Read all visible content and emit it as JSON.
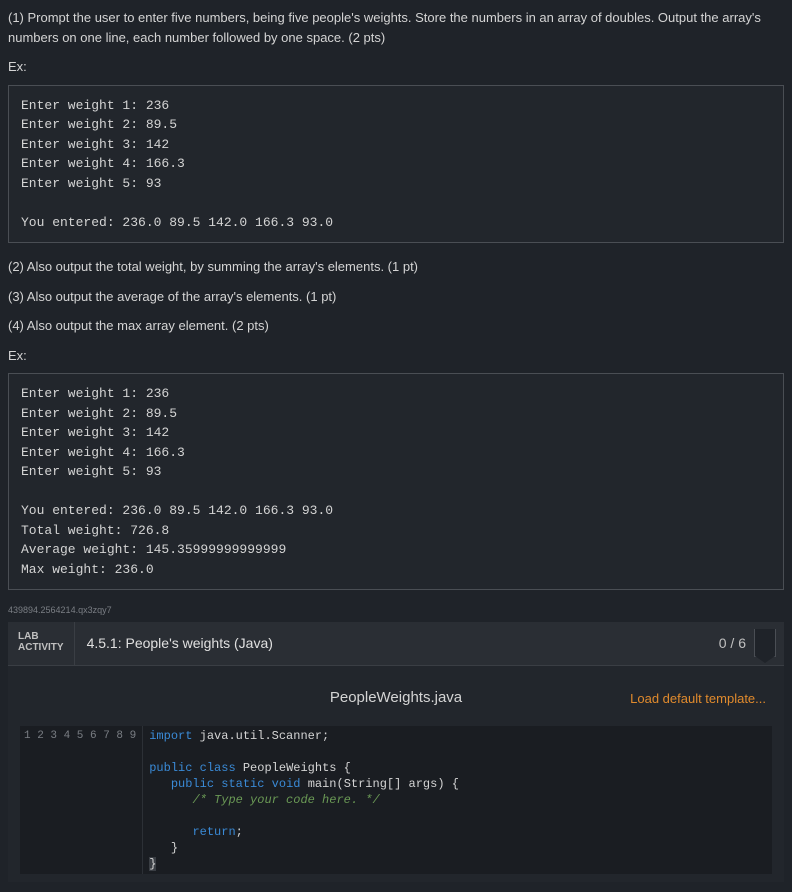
{
  "instructions": {
    "p1": "(1) Prompt the user to enter five numbers, being five people's weights. Store the numbers in an array of doubles. Output the array's numbers on one line, each number followed by one space. (2 pts)",
    "ex1_label": "Ex:",
    "ex1_code": "Enter weight 1: 236\nEnter weight 2: 89.5\nEnter weight 3: 142\nEnter weight 4: 166.3\nEnter weight 5: 93\n\nYou entered: 236.0 89.5 142.0 166.3 93.0",
    "p2": "(2) Also output the total weight, by summing the array's elements. (1 pt)",
    "p3": "(3) Also output the average of the array's elements. (1 pt)",
    "p4": "(4) Also output the max array element. (2 pts)",
    "ex2_label": "Ex:",
    "ex2_code": "Enter weight 1: 236\nEnter weight 2: 89.5\nEnter weight 3: 142\nEnter weight 4: 166.3\nEnter weight 5: 93\n\nYou entered: 236.0 89.5 142.0 166.3 93.0\nTotal weight: 726.8\nAverage weight: 145.35999999999999\nMax weight: 236.0"
  },
  "watermark": "439894.2564214.qx3zqy7",
  "lab": {
    "tag_line1": "LAB",
    "tag_line2": "ACTIVITY",
    "title": "4.5.1: People's weights (Java)",
    "score": "0 / 6"
  },
  "editor": {
    "file_name": "PeopleWeights.java",
    "load_template": "Load default template...",
    "gutter": "1\n2\n3\n4\n5\n6\n7\n8\n9",
    "code": {
      "l1_kw": "import",
      "l1_rest": " java.util.Scanner;",
      "l3_kw1": "public",
      "l3_kw2": "class",
      "l3_cls": "PeopleWeights",
      "l3_brace": " {",
      "l4_kw1": "public",
      "l4_kw2": "static",
      "l4_kw3": "void",
      "l4_fn": "main",
      "l4_sig": "(String[] args) {",
      "l5_indent": "      ",
      "l5_comment": "/* Type your code here. */",
      "l7_indent": "      ",
      "l7_kw": "return",
      "l7_semi": ";",
      "l8_indent": "   ",
      "l8_brace": "}",
      "l9_brace": "}"
    }
  }
}
